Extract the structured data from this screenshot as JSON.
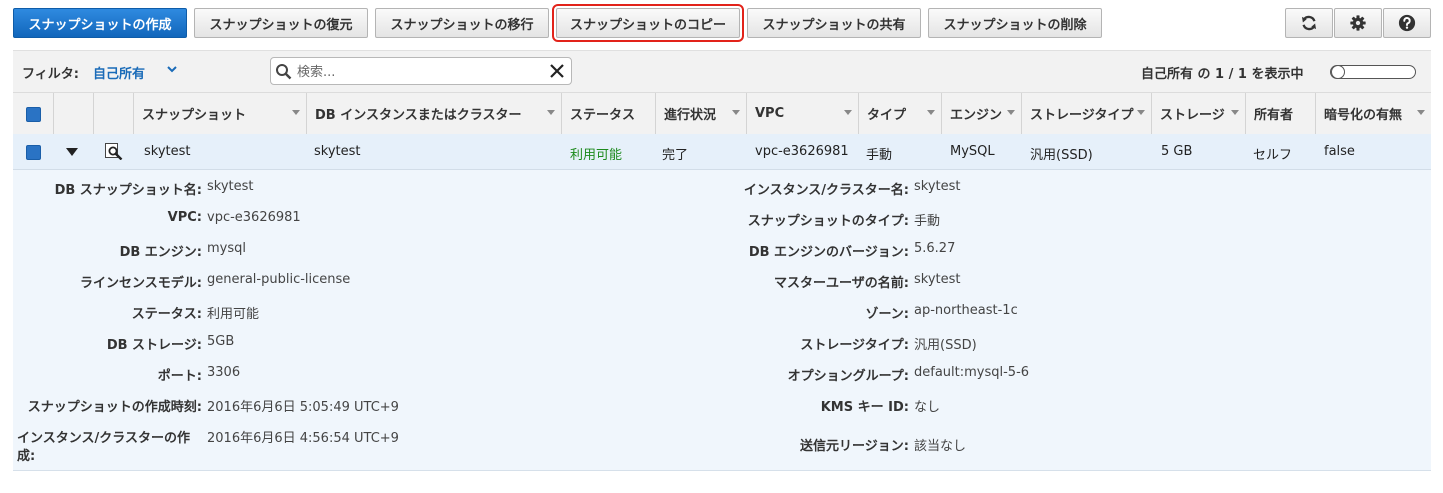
{
  "toolbar": {
    "buttons": [
      {
        "label": "スナップショットの作成"
      },
      {
        "label": "スナップショットの復元"
      },
      {
        "label": "スナップショットの移行"
      },
      {
        "label": "スナップショットのコピー"
      },
      {
        "label": "スナップショットの共有"
      },
      {
        "label": "スナップショットの削除"
      }
    ],
    "icons": [
      "refresh-icon",
      "gear-icon",
      "help-icon"
    ],
    "accent": "#1a73c8",
    "highlight": "#e2231a"
  },
  "filter": {
    "label": "フィルタ:",
    "value": "自己所有",
    "search_placeholder": "検索...",
    "count_text": "自己所有 の 1 / 1 を表示中"
  },
  "table": {
    "columns": [
      "スナップショット",
      "DB インスタンスまたはクラスター",
      "ステータス",
      "進行状況",
      "VPC",
      "タイプ",
      "エンジン",
      "ストレージタイプ",
      "ストレージ",
      "所有者",
      "暗号化の有無"
    ],
    "row": {
      "snapshot": "skytest",
      "instance": "skytest",
      "status": "利用可能",
      "progress": "完了",
      "vpc": "vpc-e3626981",
      "type": "手動",
      "engine": "MySQL",
      "storage_type": "汎用(SSD)",
      "storage": "5 GB",
      "owner": "セルフ",
      "encrypted": "false"
    }
  },
  "details": {
    "left": [
      {
        "label": "DB スナップショット名:",
        "value": "skytest"
      },
      {
        "label": "VPC:",
        "value": "vpc-e3626981"
      },
      {
        "label": "DB エンジン:",
        "value": "mysql"
      },
      {
        "label": "ラインセンスモデル:",
        "value": "general-public-license"
      },
      {
        "label": "ステータス:",
        "value": "利用可能"
      },
      {
        "label": "DB ストレージ:",
        "value": "5GB"
      },
      {
        "label": "ポート:",
        "value": "3306"
      },
      {
        "label": "スナップショットの作成時刻:",
        "value": "2016年6月6日 5:05:49 UTC+9"
      },
      {
        "label_line1": "インスタンス/クラスターの作",
        "label_line2": "成:",
        "value": "2016年6月6日 4:56:54 UTC+9"
      }
    ],
    "right": [
      {
        "label": "インスタンス/クラスター名:",
        "value": "skytest"
      },
      {
        "label": "スナップショットのタイプ:",
        "value": "手動"
      },
      {
        "label": "DB エンジンのバージョン:",
        "value": "5.6.27"
      },
      {
        "label": "マスターユーザの名前:",
        "value": "skytest"
      },
      {
        "label": "ゾーン:",
        "value": "ap-northeast-1c"
      },
      {
        "label": "ストレージタイプ:",
        "value": "汎用(SSD)"
      },
      {
        "label": "オプショングループ:",
        "value": "default:mysql-5-6"
      },
      {
        "label": "KMS キー ID:",
        "value": "なし"
      },
      {
        "label": "送信元リージョン:",
        "value": "該当なし"
      }
    ]
  }
}
